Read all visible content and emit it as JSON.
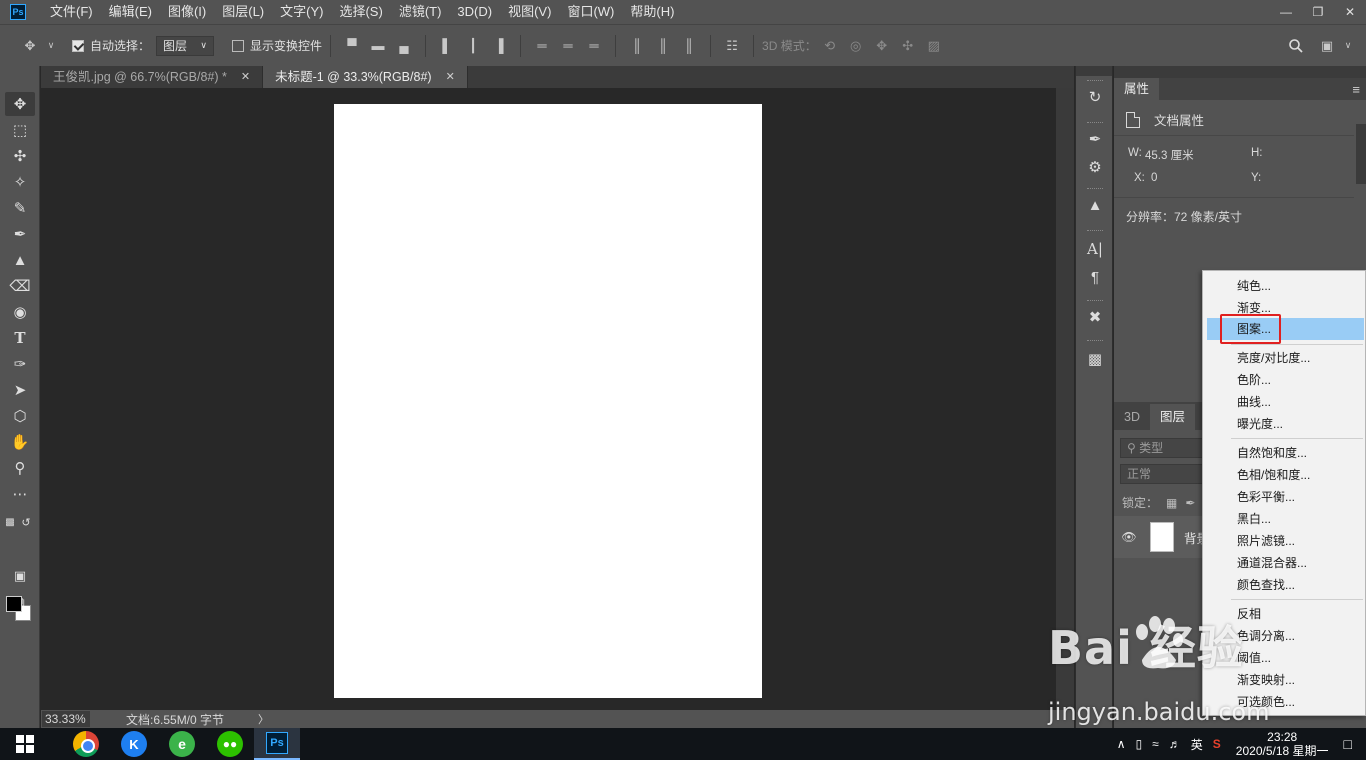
{
  "app": {
    "logo": "Ps",
    "menu": [
      "文件(F)",
      "编辑(E)",
      "图像(I)",
      "图层(L)",
      "文字(Y)",
      "选择(S)",
      "滤镜(T)",
      "3D(D)",
      "视图(V)",
      "窗口(W)",
      "帮助(H)"
    ],
    "window_controls": [
      "minimize-icon",
      "restore-icon",
      "close-icon"
    ]
  },
  "options": {
    "auto_select_label": "自动选择：",
    "auto_select_checked": true,
    "auto_select_value": "图层",
    "show_transform_label": "显示变换控件",
    "show_transform_checked": false,
    "mode_3d_label": "3D 模式："
  },
  "tabs": [
    {
      "label": "王俊凯.jpg @ 66.7%(RGB/8#) *",
      "active": false
    },
    {
      "label": "未标题-1 @ 33.3%(RGB/8#)",
      "active": true
    }
  ],
  "status": {
    "zoom": "33.33%",
    "doc_info": "文档:6.55M/0 字节",
    "arrow": "〉"
  },
  "properties": {
    "tab": "属性",
    "section": "文档属性",
    "w_label": "W:",
    "w_value": "45.3 厘米",
    "h_label": "H:",
    "x_label": "X:",
    "x_value": "0",
    "y_label": "Y:",
    "resolution": "分辨率：72 像素/英寸"
  },
  "layers": {
    "tab_3d": "3D",
    "tab_layers": "图层",
    "search_placeholder": "类型",
    "blend_mode": "正常",
    "lock_label": "锁定：",
    "layer_name": "背景"
  },
  "context_menu": {
    "group1": [
      "纯色...",
      "渐变...",
      "图案..."
    ],
    "group2": [
      "亮度/对比度...",
      "色阶...",
      "曲线...",
      "曝光度..."
    ],
    "group3": [
      "自然饱和度...",
      "色相/饱和度...",
      "色彩平衡...",
      "黑白...",
      "照片滤镜...",
      "通道混合器...",
      "颜色查找..."
    ],
    "group4": [
      "反相",
      "色调分离...",
      "阈值...",
      "渐变映射...",
      "可选颜色..."
    ],
    "highlighted": "图案...",
    "highlight_color": "#99ccf5",
    "annotation_color": "#e02020"
  },
  "taskbar": {
    "time": "23:28",
    "date": "2020/5/18 星期一",
    "ime": "英"
  },
  "watermark": {
    "brand": "Bai  经验",
    "url": "jingyan.baidu.com"
  }
}
